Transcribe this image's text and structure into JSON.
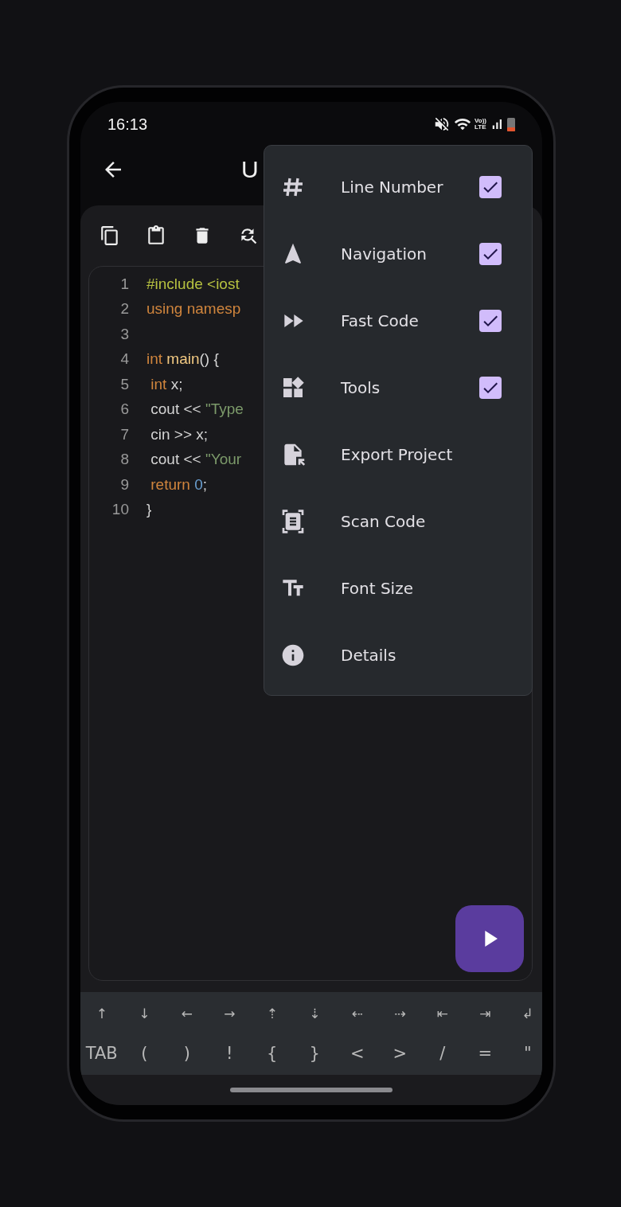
{
  "status_bar": {
    "time": "16:13",
    "network_label": [
      "Vo))",
      "LTE"
    ]
  },
  "app_bar": {
    "title": "U"
  },
  "editor": {
    "lines": [
      {
        "number": "1",
        "tokens": [
          {
            "kind": "preproc",
            "text": "#include <iost"
          }
        ]
      },
      {
        "number": "2",
        "tokens": [
          {
            "kind": "keyword",
            "text": "using namesp"
          }
        ]
      },
      {
        "number": "3"
      },
      {
        "number": "4",
        "tokens": [
          {
            "kind": "keyword",
            "text": "int "
          },
          {
            "kind": "function",
            "text": "main"
          },
          {
            "kind": "plain",
            "text": "() {"
          }
        ]
      },
      {
        "number": "5",
        "tokens": [
          {
            "kind": "keyword",
            "text": " int "
          },
          {
            "kind": "plain",
            "text": "x;"
          }
        ]
      },
      {
        "number": "6",
        "tokens": [
          {
            "kind": "plain",
            "text": " cout << "
          },
          {
            "kind": "string",
            "text": "\"Type"
          }
        ]
      },
      {
        "number": "7",
        "tokens": [
          {
            "kind": "plain",
            "text": " cin >> x;"
          }
        ]
      },
      {
        "number": "8",
        "tokens": [
          {
            "kind": "plain",
            "text": " cout << "
          },
          {
            "kind": "string",
            "text": "\"Your"
          }
        ]
      },
      {
        "number": "9",
        "tokens": [
          {
            "kind": "keyword",
            "text": " return "
          },
          {
            "kind": "number",
            "text": "0"
          },
          {
            "kind": "plain",
            "text": ";"
          }
        ]
      },
      {
        "number": "10",
        "tokens": [
          {
            "kind": "plain",
            "text": "}"
          }
        ]
      }
    ]
  },
  "menu": {
    "items": [
      {
        "label": "Line Number",
        "kind": "check",
        "checked": true
      },
      {
        "label": "Navigation",
        "kind": "check",
        "checked": true
      },
      {
        "label": "Fast Code",
        "kind": "check",
        "checked": true
      },
      {
        "label": "Tools",
        "kind": "check",
        "checked": true
      },
      {
        "label": "Export Project",
        "kind": "action"
      },
      {
        "label": "Scan Code",
        "kind": "action"
      },
      {
        "label": "Font Size",
        "kind": "action"
      },
      {
        "label": "Details",
        "kind": "action"
      }
    ]
  },
  "key_bar": {
    "rows": [
      [
        "↑",
        "↓",
        "←",
        "→",
        "⇡",
        "⇣",
        "⇠",
        "⇢",
        "⇤",
        "⇥",
        "↲"
      ],
      [
        "TAB",
        "(",
        ")",
        "!",
        "{",
        "}",
        "<",
        ">",
        "/",
        "=",
        "\""
      ]
    ]
  }
}
